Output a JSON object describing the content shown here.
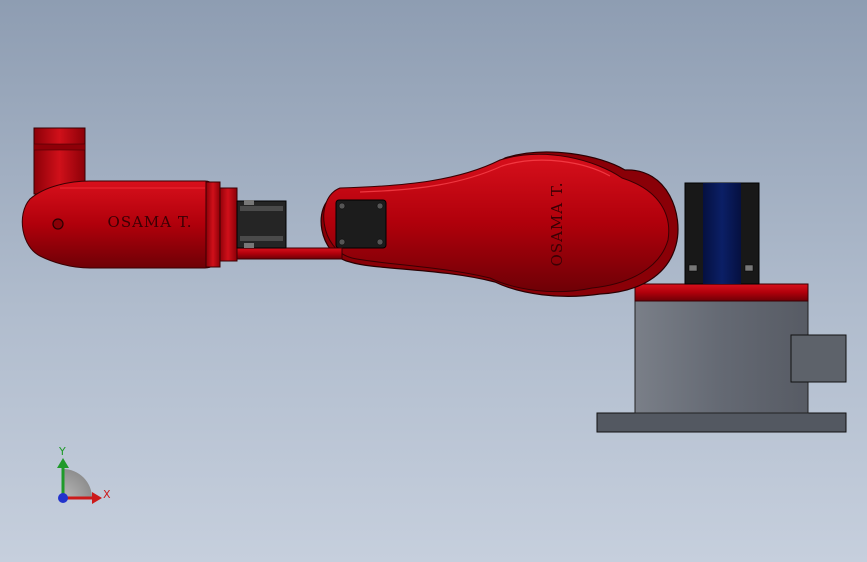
{
  "viewport": {
    "background_top": "#8e9db2",
    "background_bottom": "#c6cfdd"
  },
  "model": {
    "upper_arm_engraving": "OSAMA T.",
    "forearm_engraving": "OSAMA T.",
    "arm_color": "#b0000b",
    "base_color": "#5f646e",
    "motor_color": "#0b1f66"
  },
  "triad": {
    "x_label": "X",
    "y_label": "Y",
    "x_color": "#cc1a1a",
    "y_color": "#1f9a2a",
    "z_color": "#2233cc"
  }
}
